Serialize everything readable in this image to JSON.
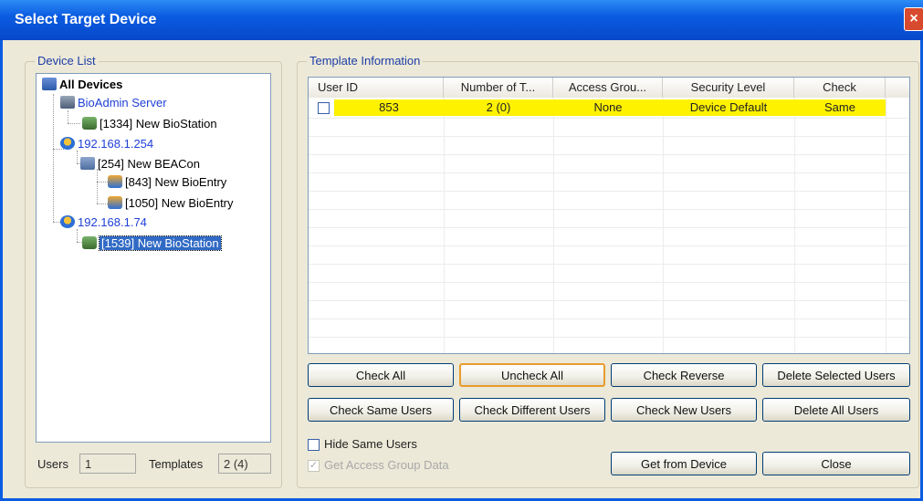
{
  "window": {
    "title": "Select Target Device",
    "close_glyph": "×"
  },
  "device_list": {
    "legend": "Device List",
    "nodes": [
      {
        "label": "All Devices",
        "icon": "devices-icon"
      },
      {
        "label": "BioAdmin Server",
        "icon": "server-icon"
      },
      {
        "label": "[1334] New BioStation",
        "icon": "biostation-icon"
      },
      {
        "label": "192.168.1.254",
        "icon": "network-icon"
      },
      {
        "label": "[254] New BEACon",
        "icon": "beacon-icon"
      },
      {
        "label": "[843] New BioEntry",
        "icon": "bioentry-icon"
      },
      {
        "label": "[1050] New BioEntry",
        "icon": "bioentry-icon"
      },
      {
        "label": "192.168.1.74",
        "icon": "network-icon"
      },
      {
        "label": "[1539] New BioStation",
        "icon": "biostation-icon"
      }
    ],
    "selected": "[1539] New BioStation"
  },
  "stats": {
    "users_label": "Users",
    "users_value": "1",
    "templates_label": "Templates",
    "templates_value": "2 (4)"
  },
  "template_info": {
    "legend": "Template Information",
    "columns": [
      "User ID",
      "Number of T...",
      "Access Grou...",
      "Security Level",
      "Check"
    ],
    "rows": [
      {
        "checked": false,
        "user_id": "853",
        "num_templates": "2 (0)",
        "access_group": "None",
        "security_level": "Device Default",
        "check": "Same"
      }
    ],
    "highlight_color": "#fff200"
  },
  "buttons": {
    "check_all": "Check All",
    "uncheck_all": "Uncheck All",
    "check_reverse": "Check Reverse",
    "delete_selected": "Delete Selected Users",
    "check_same": "Check Same Users",
    "check_different": "Check Different Users",
    "check_new": "Check New Users",
    "delete_all": "Delete All Users",
    "get_from_device": "Get from Device",
    "close": "Close"
  },
  "options": {
    "hide_same_label": "Hide Same Users",
    "hide_same_checked": false,
    "get_access_label": "Get Access Group Data",
    "get_access_checked": true,
    "get_access_enabled": false
  }
}
